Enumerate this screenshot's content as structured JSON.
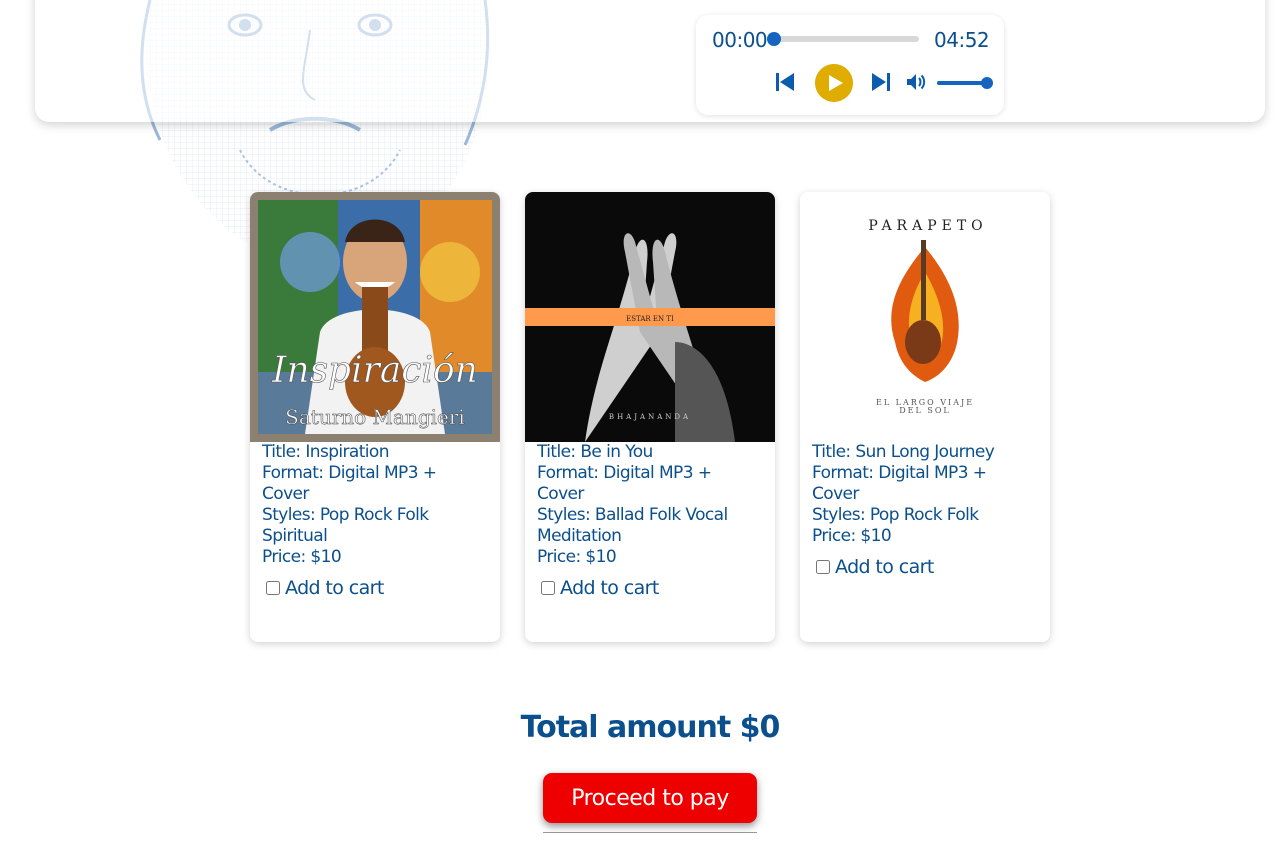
{
  "player": {
    "current_time": "00:00",
    "total_time": "04:52",
    "progress_fraction": 0.0,
    "volume_fraction": 1.0,
    "colors": {
      "accent": "#1565c0",
      "play": "#e0ac00",
      "text": "#0b4f8c"
    },
    "icons": [
      "skip-previous-icon",
      "play-icon",
      "skip-next-icon",
      "volume-icon"
    ]
  },
  "products": [
    {
      "title": "Title: Inspiration",
      "format": "Format: Digital MP3 + Cover",
      "styles": "Styles: Pop Rock Folk Spiritual",
      "price": "Price: $10",
      "add_label": "Add to cart",
      "checked": false,
      "cover_text": {
        "line1": "Inspiración",
        "line2": "Saturno Mangieri"
      }
    },
    {
      "title": "Title: Be in You",
      "format": "Format: Digital MP3 + Cover",
      "styles": "Styles: Ballad Folk Vocal Meditation",
      "price": "Price: $10",
      "add_label": "Add to cart",
      "checked": false,
      "cover_text": {
        "line1": "ESTAR EN TI",
        "line2": "BHAJANANDA"
      }
    },
    {
      "title": "Title: Sun Long Journey",
      "format": "Format: Digital MP3 + Cover",
      "styles": "Styles: Pop Rock Folk",
      "price": "Price: $10",
      "add_label": "Add to cart",
      "checked": false,
      "cover_text": {
        "line1": "PARAPETO",
        "line2": "EL LARGO VIAJE",
        "line3": "DEL SOL"
      }
    }
  ],
  "cart": {
    "total_label": "Total amount $0",
    "pay_label": "Proceed to pay",
    "pay_color": "#ee0000"
  }
}
